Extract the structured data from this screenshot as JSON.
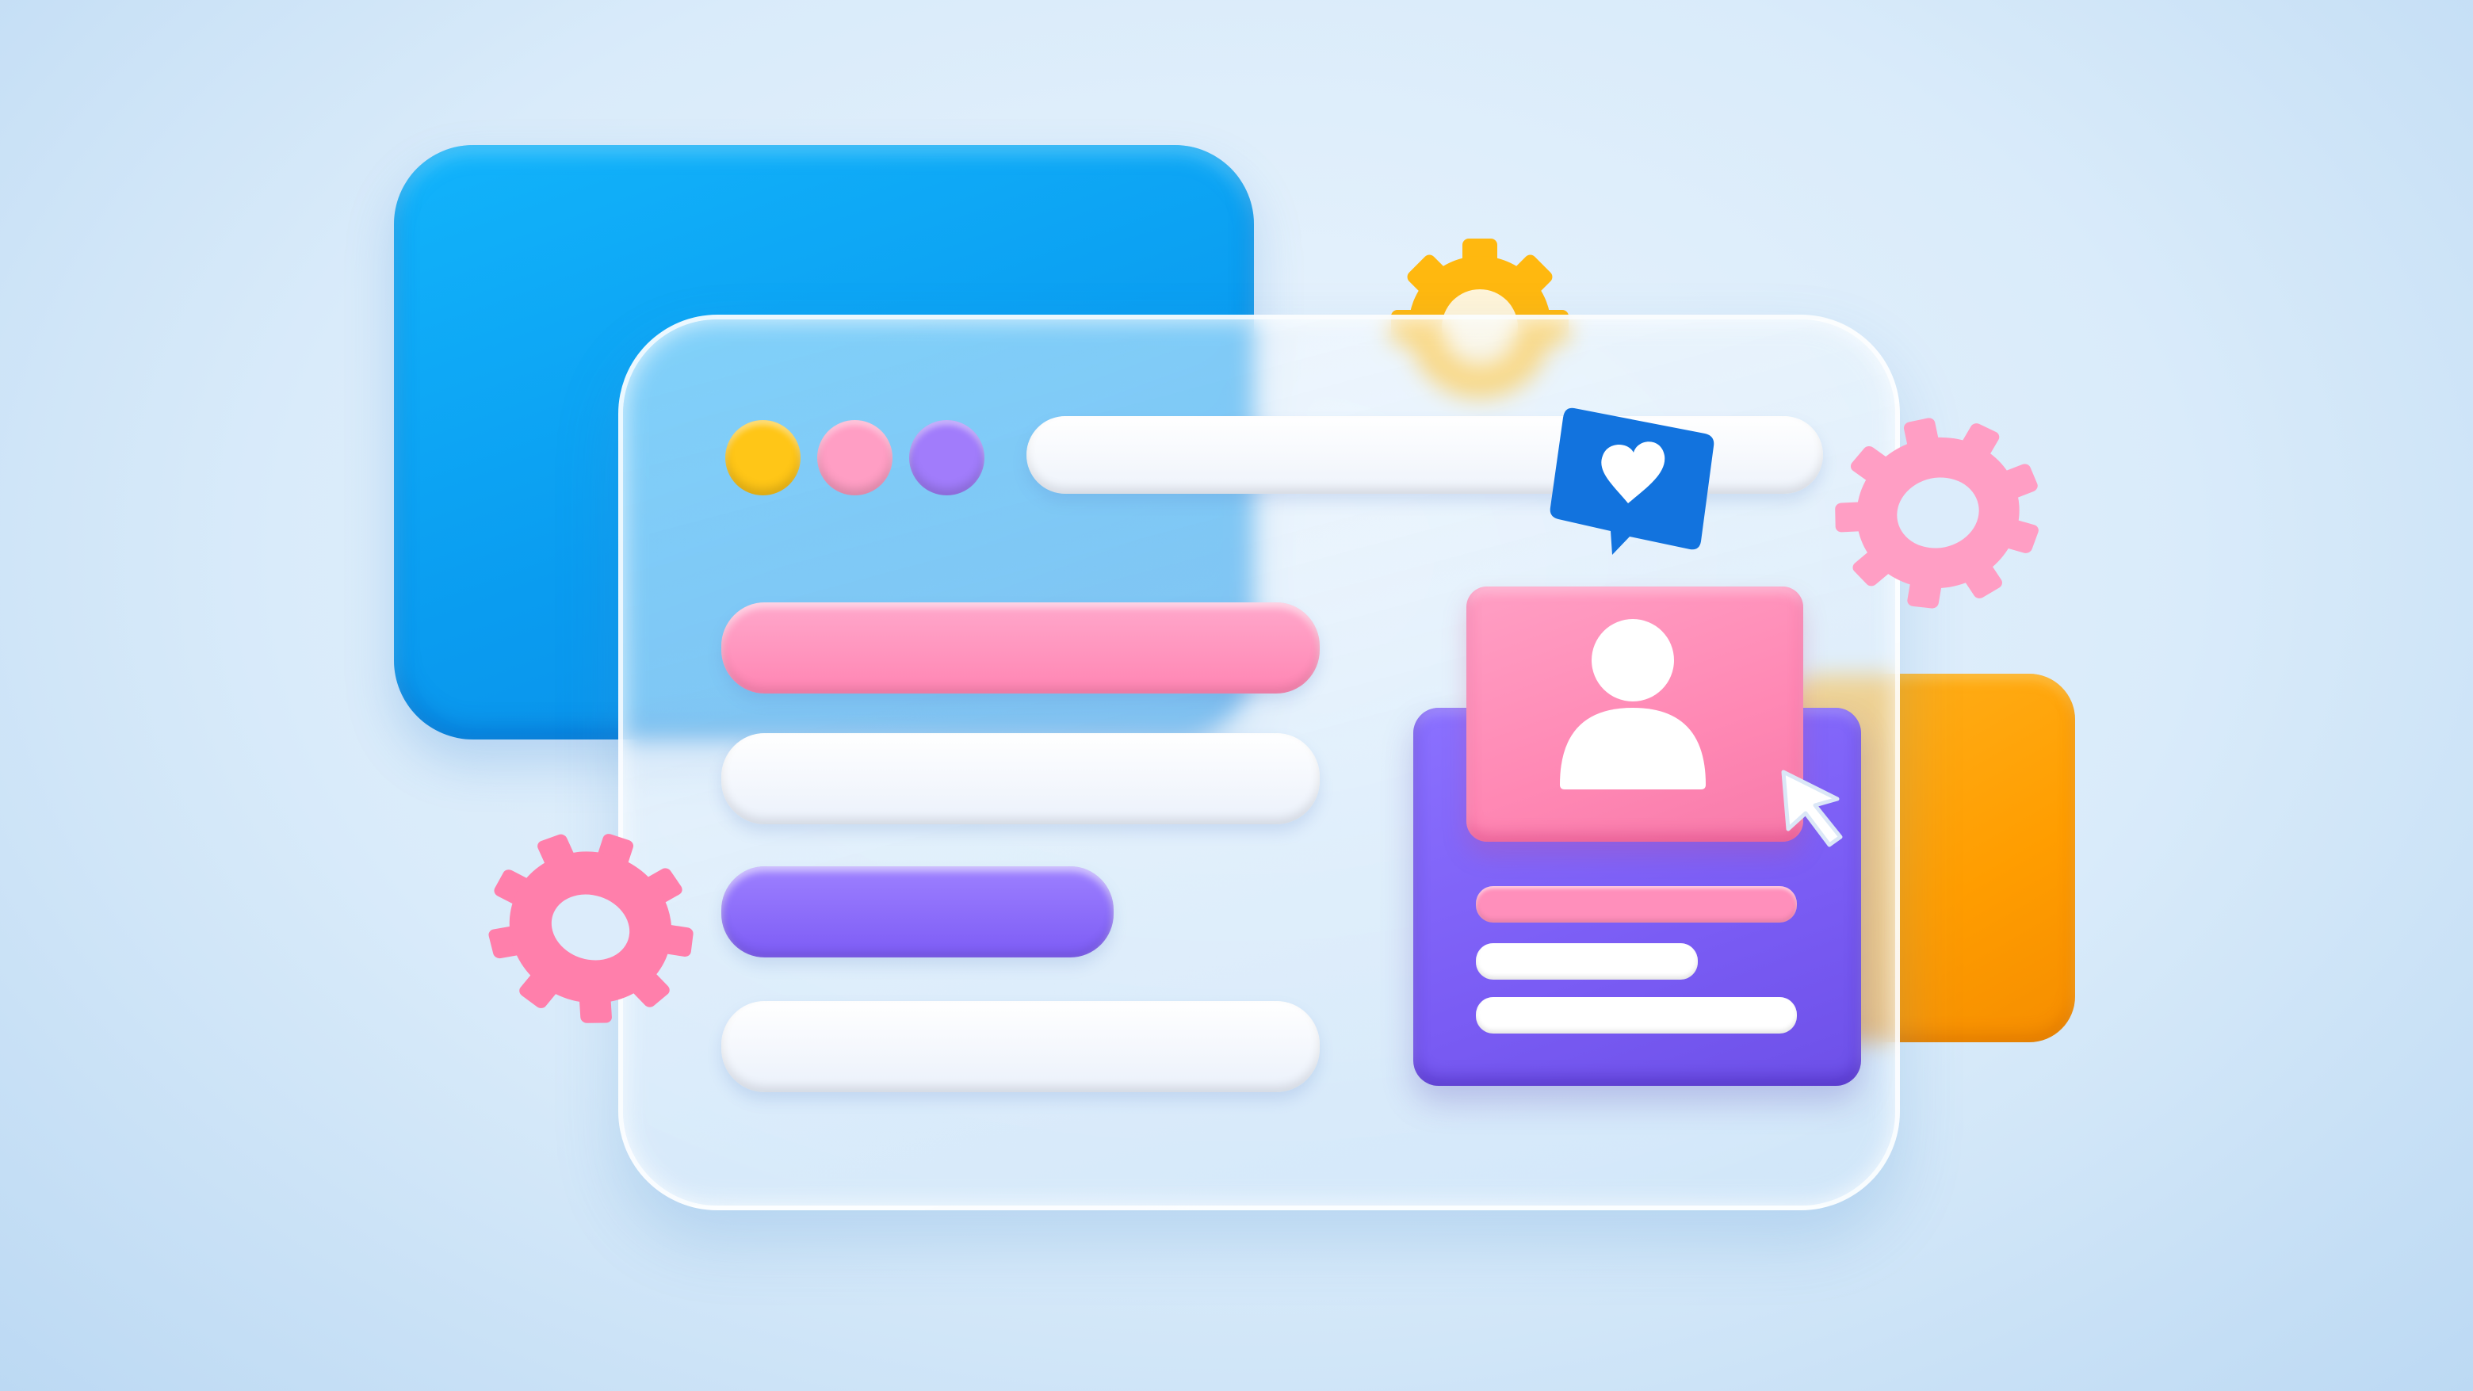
{
  "scene": {
    "background_color": "#dcedfb",
    "colors": {
      "back_window": "#0ea8f7",
      "glass_window": "#e6f2fd",
      "orange_card": "#ff9f0a",
      "pink": "#ff8fbb",
      "purple": "#7d5cf5",
      "yellow": "#ffc617",
      "white": "#ffffff",
      "like_bubble": "#1273de"
    },
    "window_controls": [
      "yellow-dot",
      "pink-dot",
      "purple-dot"
    ],
    "content_lines": [
      "pink-line",
      "white-line",
      "purple-line",
      "white-line"
    ],
    "profile_card": {
      "icon": "user-icon",
      "lines": [
        "pink-line",
        "white-line",
        "white-line"
      ]
    },
    "icons": [
      "gear-icon",
      "gear-icon",
      "gear-icon",
      "heart-icon",
      "cursor-icon",
      "user-icon"
    ]
  }
}
